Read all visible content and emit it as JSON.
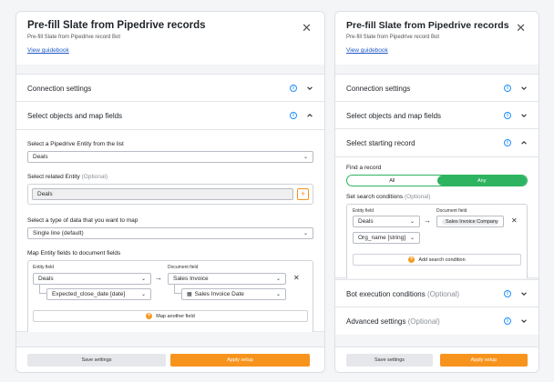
{
  "left": {
    "title": "Pre-fill Slate from Pipedrive records",
    "subtitle": "Pre-fill Slate from Pipedrive record Bot",
    "guidebook": "View guidebook",
    "connection": "Connection settings",
    "select_objects": "Select objects and map fields",
    "entity_label": "Select a Pipedrive Entity from the list",
    "entity_value": "Deals",
    "related_label": "Select related Entity",
    "related_optional": "(Optional)",
    "related_value": "Deals",
    "datatype_label": "Select a type of data that you want to map",
    "datatype_value": "Single line (default)",
    "map_label": "Map Entity fields to document fields",
    "entity_field_label": "Entity field",
    "document_field_label": "Document field",
    "entity_field_1": "Deals",
    "entity_field_2": "Expected_close_date [date]",
    "doc_field_1": "Sales Invoice",
    "doc_field_2": "Sales Invoice Date",
    "map_another": "Map another field",
    "save": "Save settings",
    "apply": "Apply setup"
  },
  "right": {
    "title": "Pre-fill Slate from Pipedrive records",
    "subtitle": "Pre-fill Slate from Pipedrive record Bot",
    "guidebook": "View guidebook",
    "connection": "Connection settings",
    "select_objects": "Select objects and map fields",
    "starting": "Select starting record",
    "find": "Find a record",
    "toggle_all": "All",
    "toggle_any": "Any",
    "conditions_label": "Set search conditions",
    "conditions_optional": "(Optional)",
    "entity_field_label": "Entity field",
    "document_field_label": "Document field",
    "entity_value": "Deals",
    "doc_value": "Sales Invoice Company C",
    "sub_value": "Org_name [string]",
    "add_condition": "Add search condition",
    "bot_exec": "Bot execution conditions",
    "bot_exec_optional": "(Optional)",
    "advanced": "Advanced settings",
    "advanced_optional": "(Optional)",
    "save": "Save settings",
    "apply": "Apply setup"
  },
  "colors": {
    "accent": "#f7941d",
    "info": "#1e8fff",
    "toggle": "#2eb360"
  }
}
